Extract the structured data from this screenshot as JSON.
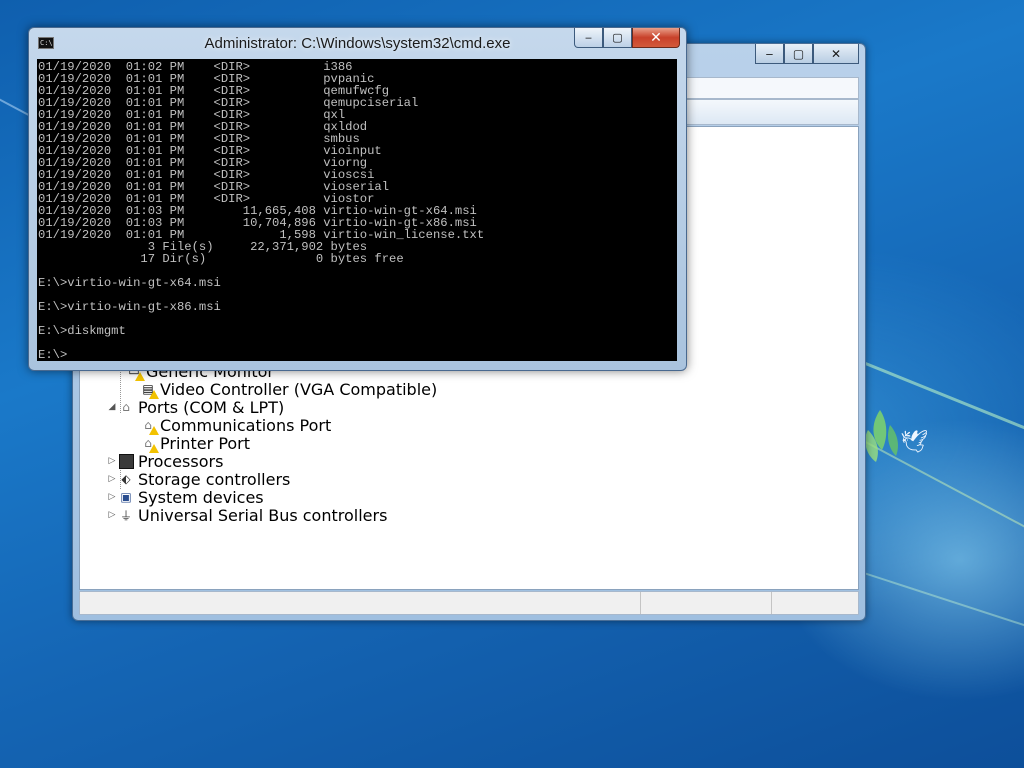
{
  "cmd_window": {
    "title": "Administrator: C:\\Windows\\system32\\cmd.exe",
    "icon_text": "C:\\",
    "controls": {
      "minimize": "‒",
      "maximize": "▢",
      "close": "✕"
    },
    "lines": [
      "01/19/2020  01:02 PM    <DIR>          i386",
      "01/19/2020  01:01 PM    <DIR>          pvpanic",
      "01/19/2020  01:01 PM    <DIR>          qemufwcfg",
      "01/19/2020  01:01 PM    <DIR>          qemupciserial",
      "01/19/2020  01:01 PM    <DIR>          qxl",
      "01/19/2020  01:01 PM    <DIR>          qxldod",
      "01/19/2020  01:01 PM    <DIR>          smbus",
      "01/19/2020  01:01 PM    <DIR>          vioinput",
      "01/19/2020  01:01 PM    <DIR>          viorng",
      "01/19/2020  01:01 PM    <DIR>          vioscsi",
      "01/19/2020  01:01 PM    <DIR>          vioserial",
      "01/19/2020  01:01 PM    <DIR>          viostor",
      "01/19/2020  01:03 PM        11,665,408 virtio-win-gt-x64.msi",
      "01/19/2020  01:03 PM        10,704,896 virtio-win-gt-x86.msi",
      "01/19/2020  01:01 PM             1,598 virtio-win_license.txt",
      "               3 File(s)     22,371,902 bytes",
      "              17 Dir(s)               0 bytes free",
      "",
      "E:\\>virtio-win-gt-x64.msi",
      "",
      "E:\\>virtio-win-gt-x86.msi",
      "",
      "E:\\>diskmgmt",
      "",
      "E:\\>"
    ]
  },
  "device_manager": {
    "controls": {
      "minimize": "‒",
      "maximize": "▢",
      "close": "✕"
    },
    "tree": [
      {
        "label": "Generic Monitor",
        "icon": "monitor-icon",
        "warning": true
      },
      {
        "label": "Video Controller (VGA Compatible)",
        "icon": "video-controller-icon",
        "warning": true
      },
      {
        "label": "Ports (COM & LPT)",
        "icon": "port-icon",
        "expander": "◢"
      },
      {
        "label": "Communications Port",
        "icon": "port-icon",
        "warning": true
      },
      {
        "label": "Printer Port",
        "icon": "port-icon",
        "warning": true
      },
      {
        "label": "Processors",
        "icon": "processor-icon",
        "expander": "▷"
      },
      {
        "label": "Storage controllers",
        "icon": "storage-icon",
        "expander": "▷"
      },
      {
        "label": "System devices",
        "icon": "system-devices-icon",
        "expander": "▷"
      },
      {
        "label": "Universal Serial Bus controllers",
        "icon": "usb-icon",
        "expander": "▷"
      }
    ]
  }
}
